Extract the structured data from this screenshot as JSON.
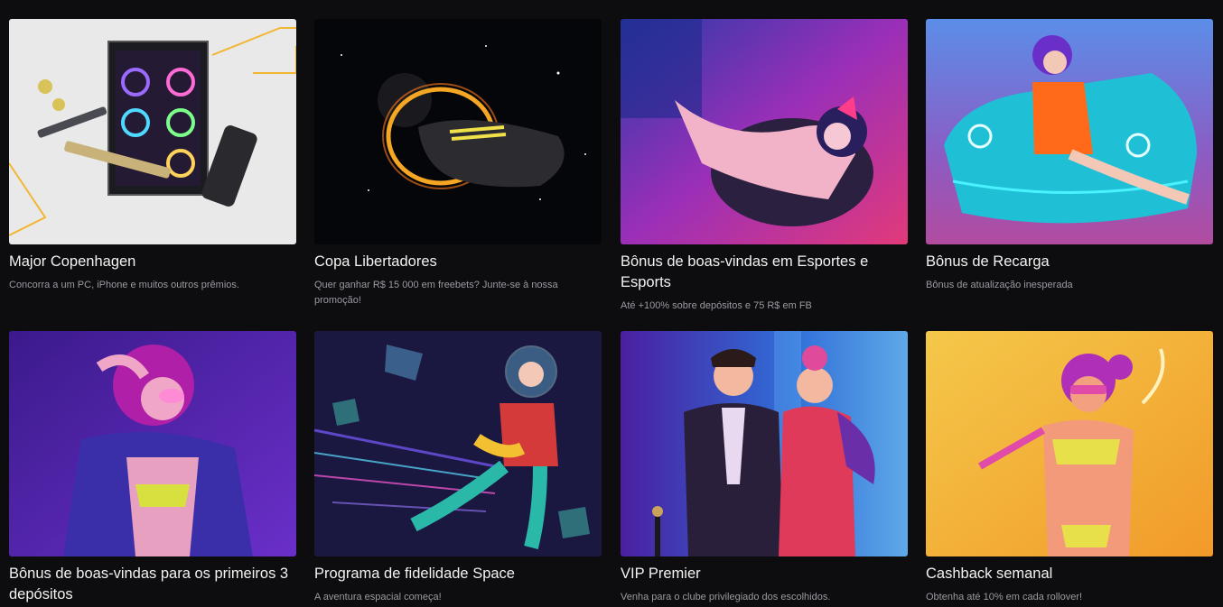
{
  "promotions": [
    {
      "title": "Major Copenhagen",
      "description": "Concorra a um PC, iPhone e muitos outros prêmios.",
      "icon": "gaming-pc-image"
    },
    {
      "title": "Copa Libertadores",
      "description": "Quer ganhar R$ 15 000 em freebets? Junte-se à nossa promoção!",
      "icon": "football-boot-image"
    },
    {
      "title": "Bônus de boas-vindas em Esportes e Esports",
      "description": "Até +100% sobre depósitos e 75 R$ em FB",
      "icon": "gamer-girl-image"
    },
    {
      "title": "Bônus de Recarga",
      "description": "Bônus de atualização inesperada",
      "icon": "neon-car-image"
    },
    {
      "title": "Bônus de boas-vindas para os primeiros 3 depósitos",
      "description": "",
      "icon": "purple-girl-image"
    },
    {
      "title": "Programa de fidelidade Space",
      "description": "A aventura espacial começa!",
      "icon": "astronaut-image"
    },
    {
      "title": "VIP Premier",
      "description": "Venha para o clube privilegiado dos escolhidos.",
      "icon": "vip-couple-image"
    },
    {
      "title": "Cashback semanal",
      "description": "Obtenha até 10% em cada rollover!",
      "icon": "golden-girl-image"
    }
  ]
}
